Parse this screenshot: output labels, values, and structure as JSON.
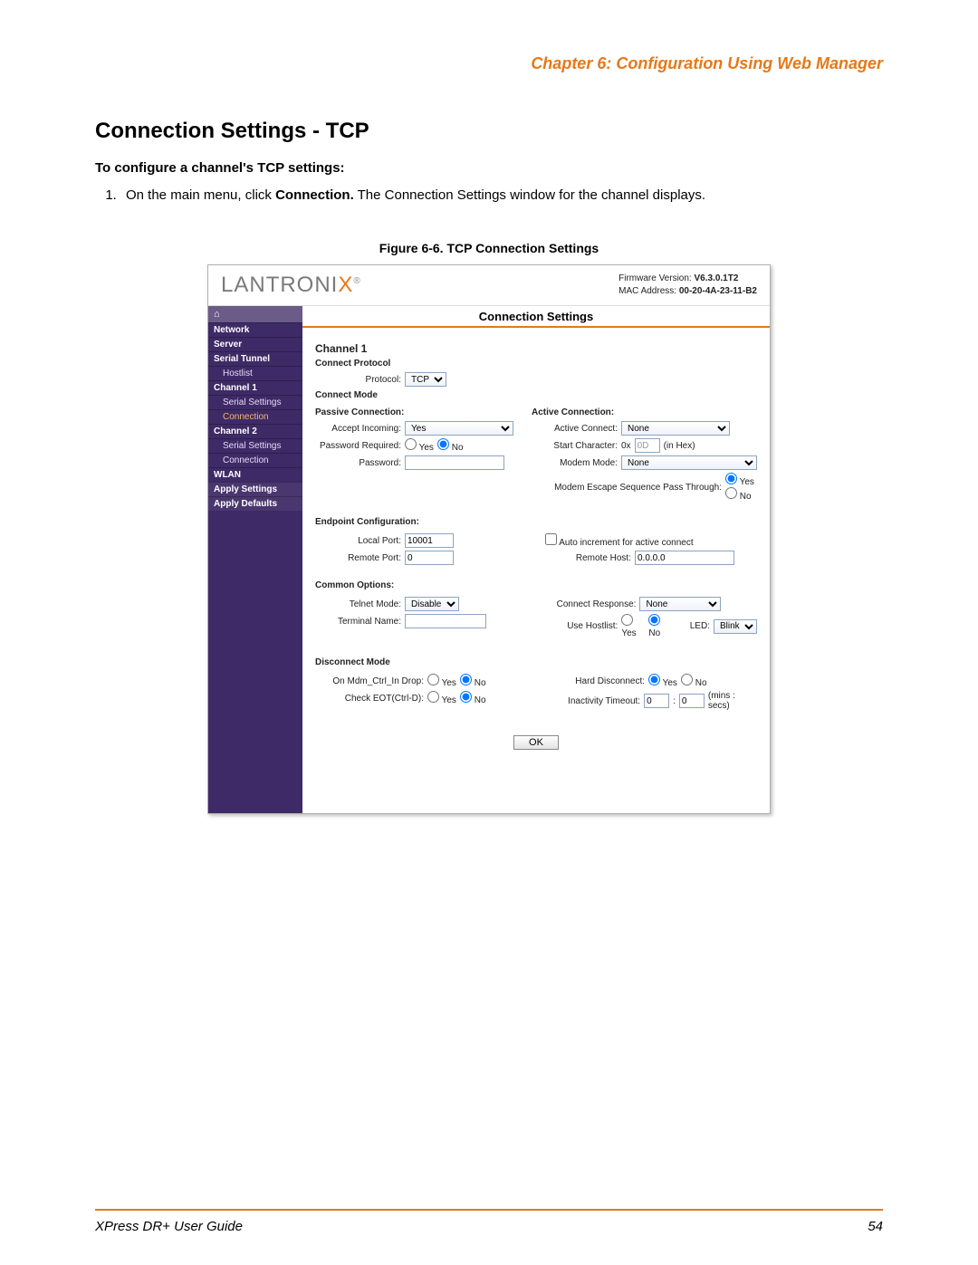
{
  "header": {
    "chapter": "Chapter 6: Configuration Using Web Manager"
  },
  "section": {
    "title": "Connection Settings - TCP",
    "subtitle": "To configure a channel's TCP settings:",
    "step1_pre": "On the main menu, click ",
    "step1_bold": "Connection.",
    "step1_post": " The Connection Settings window for the channel displays."
  },
  "figure": {
    "caption": "Figure 6-6. TCP Connection Settings"
  },
  "screenshot": {
    "logo_main": "LANTRONI",
    "logo_x": "X",
    "fw_label": "Firmware Version:",
    "fw_value": "V6.3.0.1T2",
    "mac_label": "MAC Address:",
    "mac_value": "00-20-4A-23-11-B2",
    "title": "Connection Settings",
    "nav": {
      "network": "Network",
      "server": "Server",
      "serial_tunnel": "Serial Tunnel",
      "hostlist": "Hostlist",
      "channel1": "Channel 1",
      "ch1_serial": "Serial Settings",
      "ch1_conn": "Connection",
      "channel2": "Channel 2",
      "ch2_serial": "Serial Settings",
      "ch2_conn": "Connection",
      "wlan": "WLAN",
      "apply_settings": "Apply Settings",
      "apply_defaults": "Apply Defaults"
    },
    "form": {
      "channel": "Channel 1",
      "connect_protocol": "Connect Protocol",
      "protocol_label": "Protocol:",
      "protocol_value": "TCP",
      "connect_mode": "Connect Mode",
      "passive_h": "Passive Connection:",
      "active_h": "Active Connection:",
      "accept_incoming_label": "Accept Incoming:",
      "accept_incoming_value": "Yes",
      "active_connect_label": "Active Connect:",
      "active_connect_value": "None",
      "pwd_required_label": "Password Required:",
      "start_char_label": "Start Character:",
      "start_char_prefix": "0x",
      "start_char_value": "0D",
      "in_hex": "(in Hex)",
      "pwd_label": "Password:",
      "modem_mode_label": "Modem Mode:",
      "modem_mode_value": "None",
      "mm_escape_label": "Modem Escape Sequence Pass Through:",
      "yes": "Yes",
      "no": "No",
      "endpoint_h": "Endpoint Configuration:",
      "local_port_label": "Local Port:",
      "local_port_value": "10001",
      "auto_inc": "Auto increment for active connect",
      "remote_port_label": "Remote Port:",
      "remote_port_value": "0",
      "remote_host_label": "Remote Host:",
      "remote_host_value": "0.0.0.0",
      "common_h": "Common Options:",
      "telnet_label": "Telnet Mode:",
      "telnet_value": "Disable",
      "conn_resp_label": "Connect Response:",
      "conn_resp_value": "None",
      "term_name_label": "Terminal Name:",
      "use_hostlist_label": "Use Hostlist:",
      "led_label": "LED:",
      "led_value": "Blink",
      "disc_h": "Disconnect Mode",
      "mdm_ctrl_label": "On Mdm_Ctrl_In Drop:",
      "hard_disc_label": "Hard Disconnect:",
      "check_eot_label": "Check EOT(Ctrl-D):",
      "inact_label": "Inactivity Timeout:",
      "inact_min": "0",
      "inact_sec": "0",
      "mins_secs": "(mins : secs)",
      "ok": "OK"
    }
  },
  "footer": {
    "guide": "XPress DR+ User Guide",
    "page": "54"
  }
}
